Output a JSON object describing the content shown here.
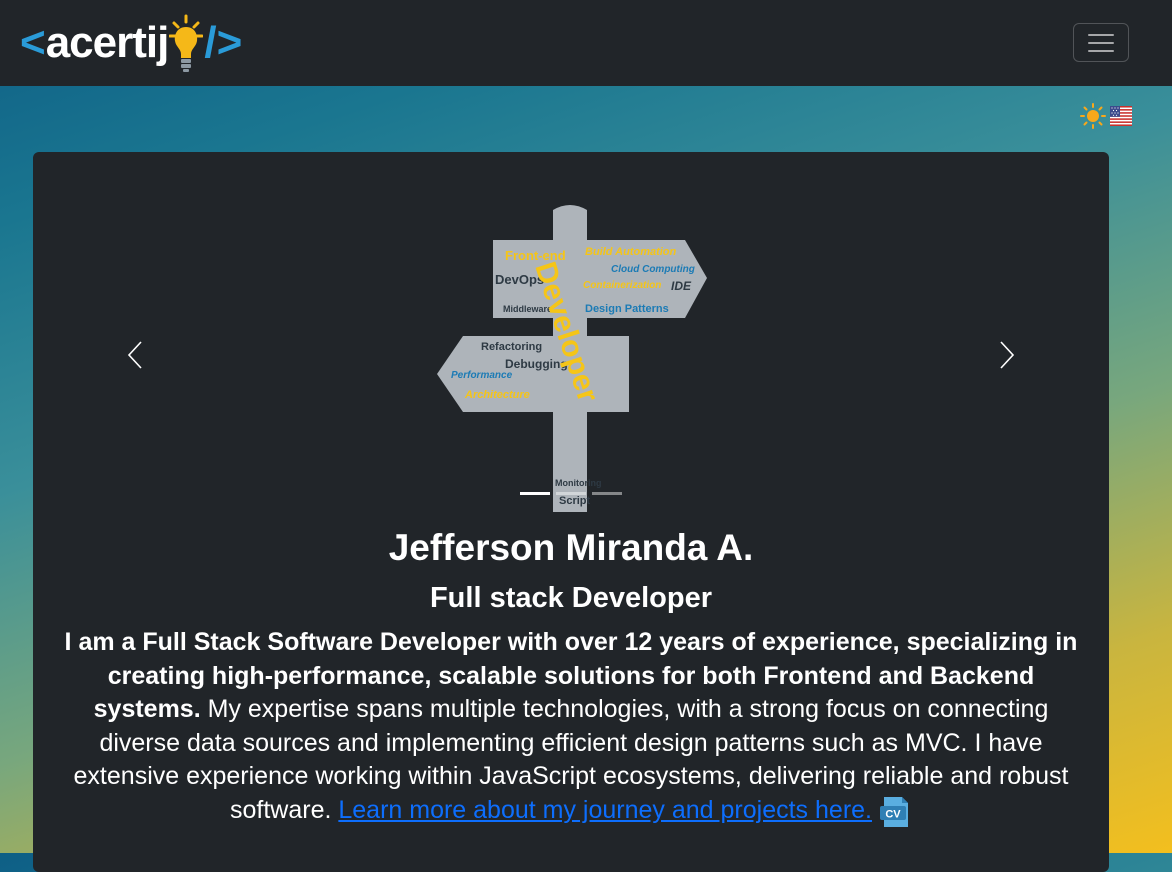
{
  "navbar": {
    "brand": {
      "open_bracket": "<",
      "name": "acertij",
      "close_bracket": "/>"
    },
    "toggler_icon": "hamburger-icon"
  },
  "utilities": {
    "theme_icon": "sun-icon",
    "language_icon": "us-flag-icon"
  },
  "carousel": {
    "image_label": "Developer",
    "slide_count": 3,
    "active_slide": 1,
    "prev_icon": "chevron-left-icon",
    "next_icon": "chevron-right-icon"
  },
  "profile": {
    "name": "Jefferson Miranda A.",
    "role": "Full stack Developer",
    "intro_bold": "I am a Full Stack Software Developer with over 12 years of experience, specializing in creating high-performance, scalable solutions for both Frontend and Backend systems.",
    "intro_rest": " My expertise spans multiple technologies, with a strong focus on connecting diverse data sources and implementing efficient design patterns such as MVC. I have extensive experience working within JavaScript ecosystems, delivering reliable and robust software. ",
    "link_text": "Learn more about my journey and projects here.",
    "cv_icon_label": "CV"
  },
  "colors": {
    "navbar_bg": "#212529",
    "card_bg": "#212529",
    "accent_blue": "#2a9bd8",
    "link": "#0d6efd",
    "bulb_yellow": "#f5b818"
  }
}
